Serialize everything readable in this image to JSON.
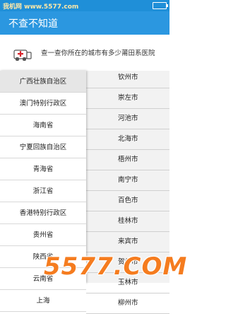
{
  "statusbar": {
    "site_label": "我机网 www.5577.com"
  },
  "appbar": {
    "title": "不查不知道"
  },
  "banner": {
    "icon": "hospital-cross-icon",
    "text": "查一查你所在的城市有多少莆田系医院"
  },
  "provinces": [
    {
      "label": "广西壮族自治区",
      "selected": true
    },
    {
      "label": "澳门特别行政区"
    },
    {
      "label": "海南省"
    },
    {
      "label": "宁夏回族自治区"
    },
    {
      "label": "青海省"
    },
    {
      "label": "浙江省"
    },
    {
      "label": "香港特别行政区"
    },
    {
      "label": "贵州省"
    },
    {
      "label": "陕西省"
    },
    {
      "label": "云南省"
    },
    {
      "label": "上海"
    }
  ],
  "cities": [
    "钦州市",
    "崇左市",
    "河池市",
    "北海市",
    "梧州市",
    "南宁市",
    "百色市",
    "桂林市",
    "来宾市",
    "贺州市",
    "玉林市",
    "柳州市"
  ],
  "watermark": {
    "text": "5577.COM"
  },
  "colors": {
    "appbar": "#2b97e0",
    "watermark": "#f57c1f"
  }
}
